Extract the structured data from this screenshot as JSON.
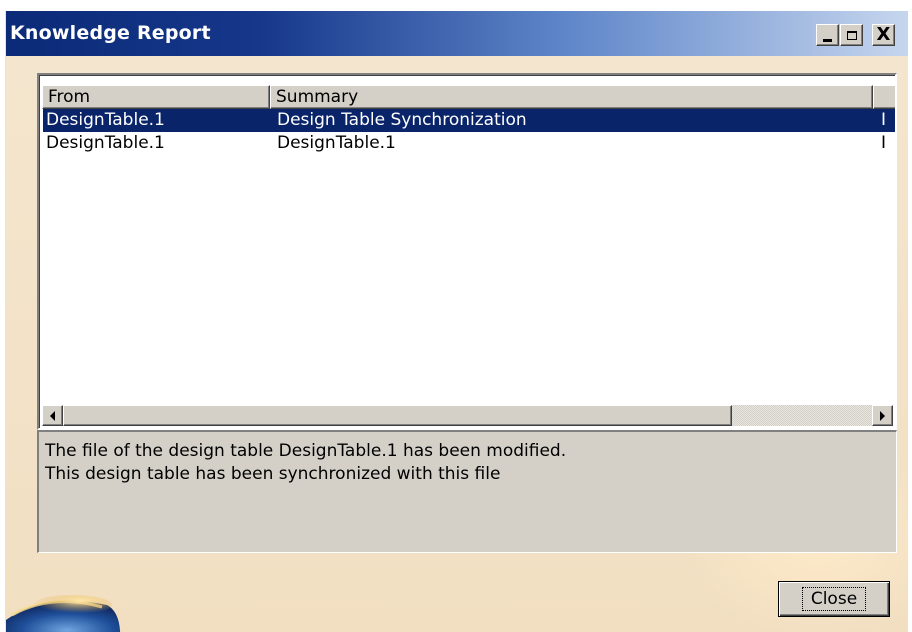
{
  "window": {
    "title": "Knowledge Report",
    "controls": {
      "minimize": "_",
      "maximize": "□",
      "close": "X"
    }
  },
  "table": {
    "columns": [
      "From",
      "Summary",
      ""
    ],
    "rows": [
      {
        "from": "DesignTable.1",
        "summary": "Design Table Synchronization",
        "third": "I",
        "selected": true
      },
      {
        "from": "DesignTable.1",
        "summary": "DesignTable.1",
        "third": "I",
        "selected": false
      }
    ]
  },
  "description": {
    "lines": [
      "The file of the design table DesignTable.1 has been modified.",
      "This design table has been synchronized with this file"
    ]
  },
  "footer": {
    "close_label": "Close"
  },
  "colors": {
    "selection": "#0a246a",
    "title_start": "#0b2a78",
    "title_end": "#c6d6ee",
    "dialog_bg": "#f3e2c8",
    "control_face": "#d4d0c8"
  }
}
